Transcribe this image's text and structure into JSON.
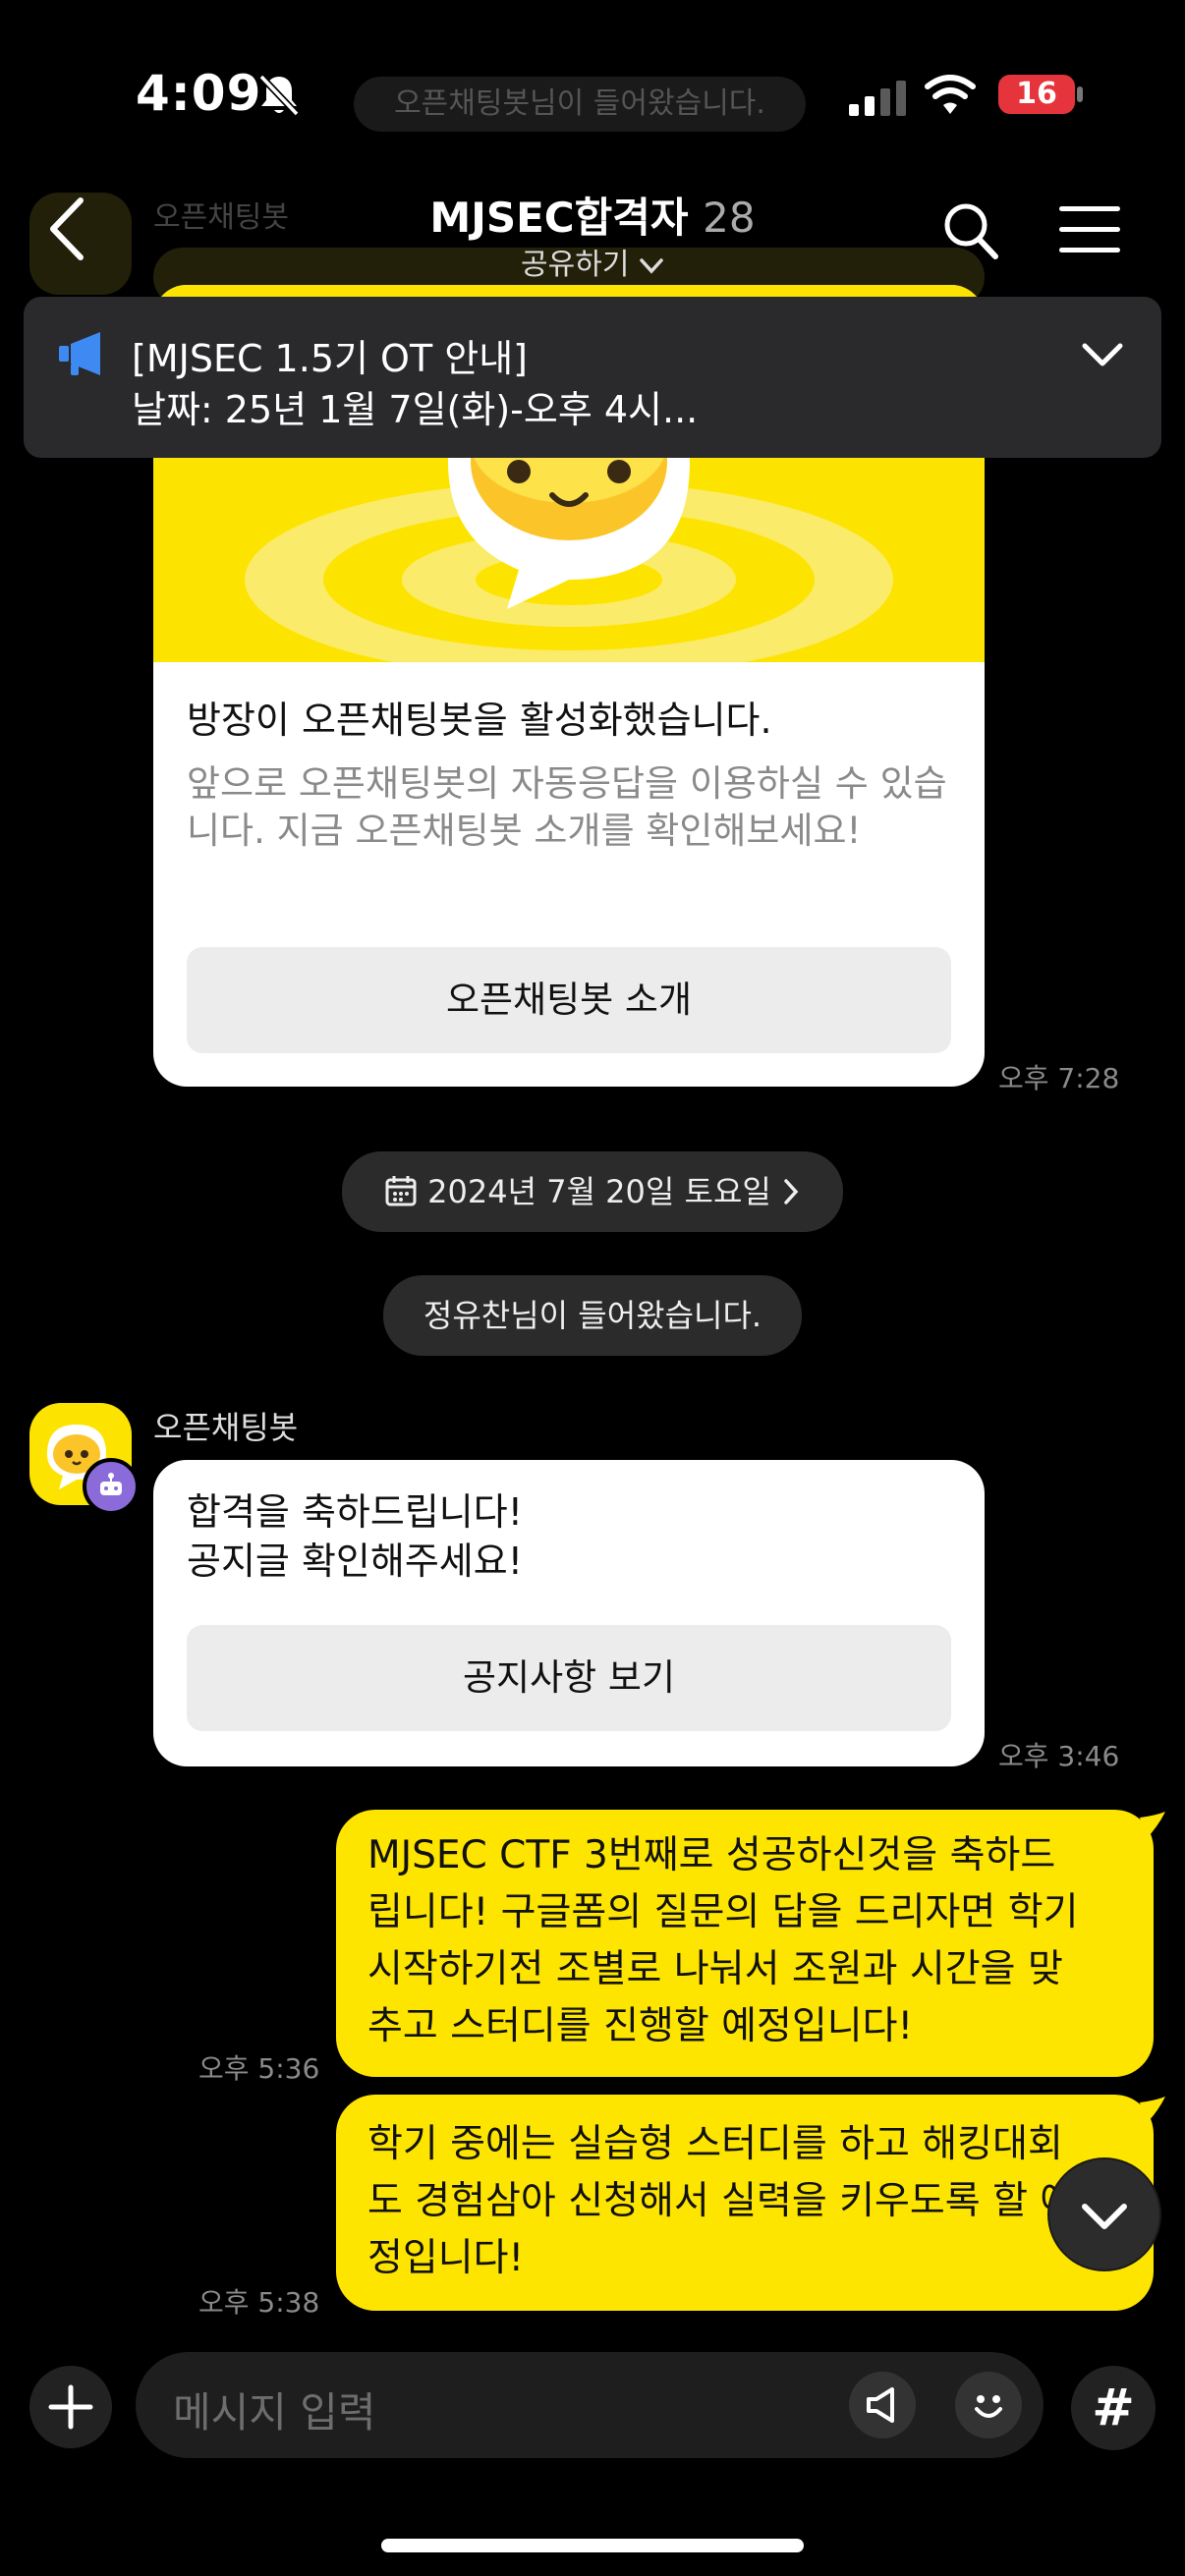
{
  "status_bar": {
    "time": "4:09",
    "toast": "오픈채팅봇님이 들어왔습니다.",
    "battery": "16"
  },
  "header": {
    "title": "MJSEC합격자",
    "member_count": "28",
    "share_label": "공유하기",
    "faded_sender": "오픈채팅봇"
  },
  "notice": {
    "title": "[MJSEC 1.5기 OT 안내]",
    "body": "날짜: 25년 1월 7일(화)-오후 4시..."
  },
  "bot_activation_card": {
    "title": "방장이 오픈채팅봇을 활성화했습니다.",
    "description": "앞으로 오픈채팅봇의 자동응답을 이용하실 수 있습니다. 지금 오픈채팅봇 소개를 확인해보세요!",
    "button_label": "오픈채팅봇 소개",
    "time": "오후 7:28"
  },
  "date_divider": "2024년 7월 20일 토요일",
  "join_notice": "정유찬님이 들어왔습니다.",
  "bot_message": {
    "sender": "오픈채팅봇",
    "line1": "합격을 축하드립니다!",
    "line2": "공지글 확인해주세요!",
    "button_label": "공지사항 보기",
    "time": "오후 3:46"
  },
  "my_messages": [
    {
      "lines": [
        "MJSEC CTF 3번째로 성공하신것을 축하드",
        "립니다! 구글폼의 질문의 답을 드리자면 학기",
        "시작하기전  조별로 나눠서 조원과 시간을 맞",
        "추고 스터디를 진행할 예정입니다!"
      ],
      "time": "오후 5:36"
    },
    {
      "lines": [
        "학기 중에는 실습형 스터디를 하고 해킹대회",
        "도 경험삼아 신청해서 실력을 키우도록 할 예",
        "정입니다!"
      ],
      "time": "오후 5:38"
    }
  ],
  "input_bar": {
    "placeholder": "메시지 입력"
  },
  "colors": {
    "bubble_yellow": "#fee500",
    "card_white": "#ffffff",
    "background": "#000000",
    "notice_icon_blue": "#3d8bf2",
    "bot_badge_purple": "#8b6bd9"
  }
}
